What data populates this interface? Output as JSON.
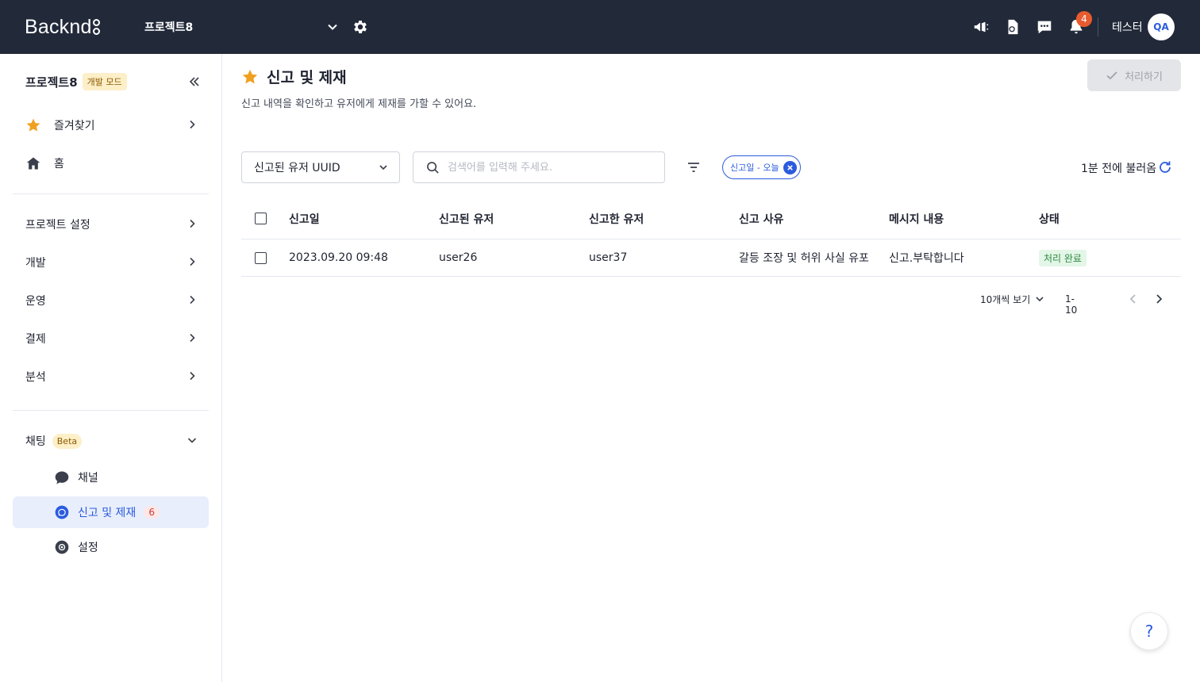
{
  "header": {
    "logo_text": "Backnd",
    "project_name": "프로젝트8",
    "notification_count": "4",
    "user_name": "테스터",
    "avatar_initials": "QA"
  },
  "sidebar": {
    "project_title": "프로젝트8",
    "mode_badge": "개발 모드",
    "favorites": "즐겨찾기",
    "home": "홈",
    "sections": [
      {
        "label": "프로젝트 설정"
      },
      {
        "label": "개발"
      },
      {
        "label": "운영"
      },
      {
        "label": "결제"
      },
      {
        "label": "분석"
      }
    ],
    "chat": {
      "label": "채팅",
      "badge": "Beta",
      "items": [
        {
          "label": "채널"
        },
        {
          "label": "신고 및 제재",
          "count": "6"
        },
        {
          "label": "설정"
        }
      ]
    }
  },
  "page": {
    "title": "신고 및 제재",
    "description": "신고 내역을 확인하고 유저에게 제재를 가할 수 있어요.",
    "process_button": "처리하기",
    "search_column": "신고된 유저 UUID",
    "search_placeholder": "검색어를 입력해 주세요.",
    "filter_chip": "신고일 - 오늘",
    "refresh_text": "1분 전에 불러옴"
  },
  "table": {
    "headers": [
      "신고일",
      "신고된 유저",
      "신고한 유저",
      "신고 사유",
      "메시지 내용",
      "상태"
    ],
    "rows": [
      {
        "date": "2023.09.20 09:48",
        "reported_user": "user26",
        "reporter": "user37",
        "reason": "갈등 조장 및 허위 사실 유포",
        "message": "신고.부탁합니다",
        "status": "처리 완료"
      }
    ]
  },
  "pagination": {
    "per_page": "10개씩 보기",
    "range": "1-10"
  },
  "help": {
    "label": "?"
  },
  "colors": {
    "topbar": "#222a3a",
    "accent": "#2b5bde",
    "star": "#f0a020",
    "notification": "#e85b2f",
    "status_done_bg": "#e3f6e7",
    "status_done_text": "#2e8a43"
  }
}
